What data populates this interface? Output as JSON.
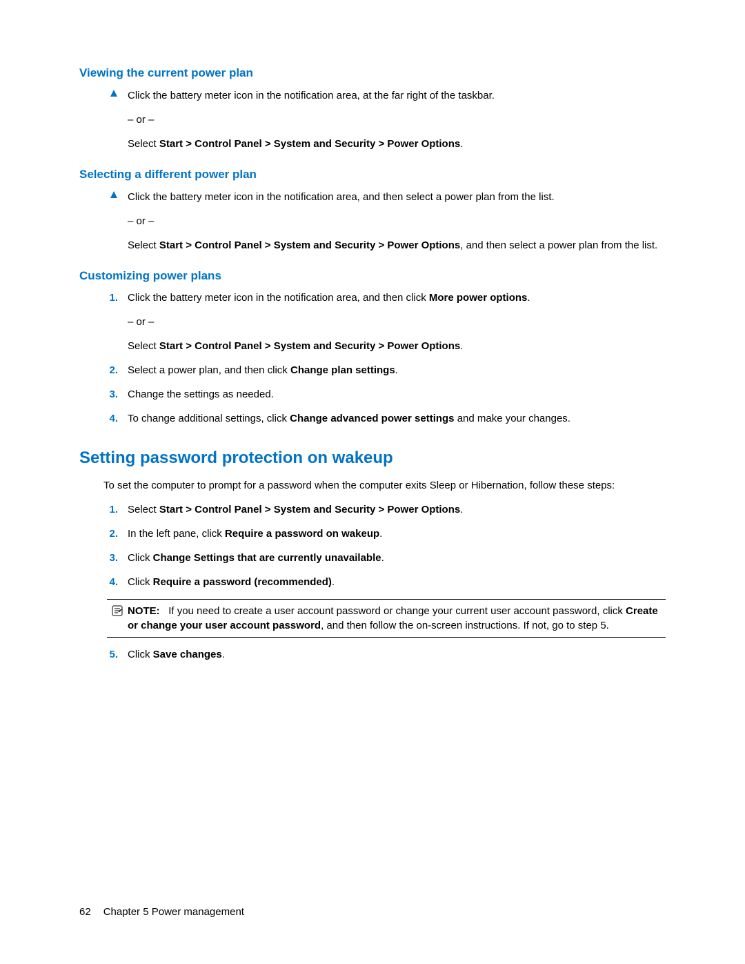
{
  "sections": {
    "s1": {
      "heading": "Viewing the current power plan",
      "p1": "Click the battery meter icon in the notification area, at the far right of the taskbar.",
      "or": "– or –",
      "p2_pre": "Select ",
      "p2_bold": "Start > Control Panel > System and Security > Power Options",
      "p2_post": "."
    },
    "s2": {
      "heading": "Selecting a different power plan",
      "p1": "Click the battery meter icon in the notification area, and then select a power plan from the list.",
      "or": "– or –",
      "p2_pre": "Select ",
      "p2_bold": "Start > Control Panel > System and Security > Power Options",
      "p2_post": ", and then select a power plan from the list."
    },
    "s3": {
      "heading": "Customizing power plans",
      "items": {
        "n1": "1.",
        "i1_a": "Click the battery meter icon in the notification area, and then click ",
        "i1_b": "More power options",
        "i1_c": ".",
        "or": "– or –",
        "i1_d": "Select ",
        "i1_e": "Start > Control Panel > System and Security > Power Options",
        "i1_f": ".",
        "n2": "2.",
        "i2_a": "Select a power plan, and then click ",
        "i2_b": "Change plan settings",
        "i2_c": ".",
        "n3": "3.",
        "i3": "Change the settings as needed.",
        "n4": "4.",
        "i4_a": "To change additional settings, click ",
        "i4_b": "Change advanced power settings",
        "i4_c": " and make your changes."
      }
    },
    "s4": {
      "heading": "Setting password protection on wakeup",
      "intro": "To set the computer to prompt for a password when the computer exits Sleep or Hibernation, follow these steps:",
      "items": {
        "n1": "1.",
        "i1_a": "Select ",
        "i1_b": "Start > Control Panel > System and Security > Power Options",
        "i1_c": ".",
        "n2": "2.",
        "i2_a": "In the left pane, click ",
        "i2_b": "Require a password on wakeup",
        "i2_c": ".",
        "n3": "3.",
        "i3_a": "Click ",
        "i3_b": "Change Settings that are currently unavailable",
        "i3_c": ".",
        "n4": "4.",
        "i4_a": "Click ",
        "i4_b": "Require a password (recommended)",
        "i4_c": ".",
        "note_label": "NOTE:",
        "note_a": "If you need to create a user account password or change your current user account password, click ",
        "note_b": "Create or change your user account password",
        "note_c": ", and then follow the on-screen instructions. If not, go to step 5.",
        "n5": "5.",
        "i5_a": "Click ",
        "i5_b": "Save changes",
        "i5_c": "."
      }
    }
  },
  "footer": {
    "page": "62",
    "chapter": "Chapter 5   Power management"
  }
}
